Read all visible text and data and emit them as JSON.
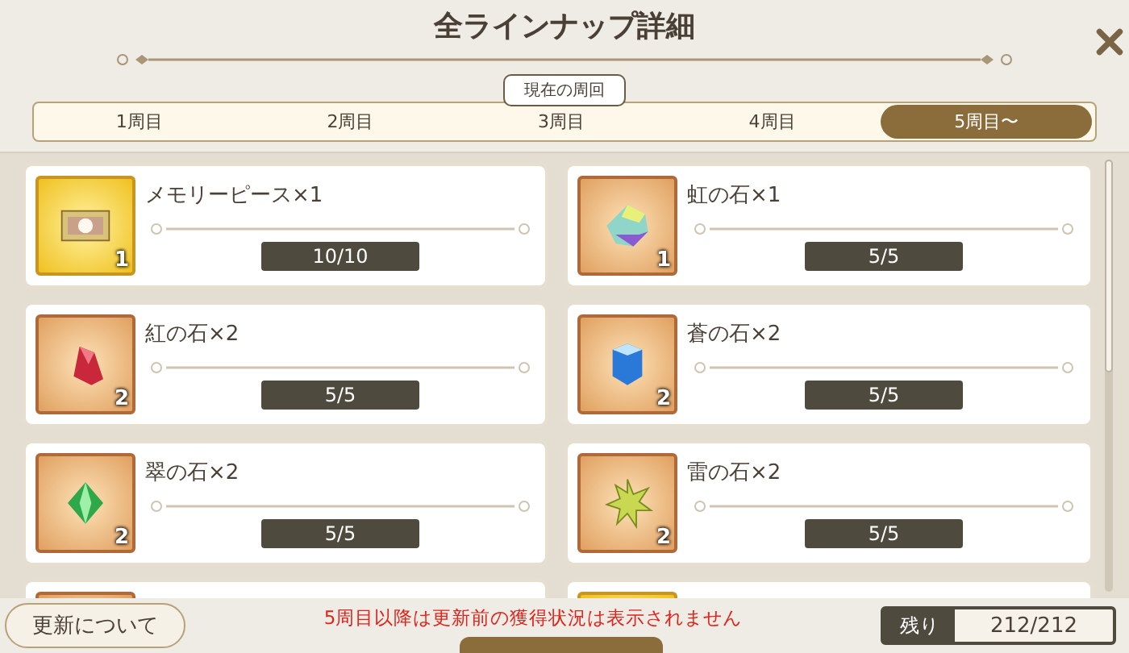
{
  "title": "全ラインナップ詳細",
  "tabs": [
    {
      "label": "1周目",
      "selected": false,
      "current": false
    },
    {
      "label": "2周目",
      "selected": false,
      "current": false
    },
    {
      "label": "3周目",
      "selected": false,
      "current": true
    },
    {
      "label": "4周目",
      "selected": false,
      "current": false
    },
    {
      "label": "5周目〜",
      "selected": true,
      "current": false
    }
  ],
  "current_tooltip": "現在の周回",
  "items": [
    {
      "kind": "film",
      "name": "メモリーピース×1",
      "count": "1",
      "progress": "10/10"
    },
    {
      "kind": "rainbow",
      "name": "虹の石×1",
      "count": "1",
      "progress": "5/5"
    },
    {
      "kind": "red",
      "name": "紅の石×2",
      "count": "2",
      "progress": "5/5"
    },
    {
      "kind": "blue",
      "name": "蒼の石×2",
      "count": "2",
      "progress": "5/5"
    },
    {
      "kind": "green",
      "name": "翠の石×2",
      "count": "2",
      "progress": "5/5"
    },
    {
      "kind": "star",
      "name": "雷の石×2",
      "count": "2",
      "progress": "5/5"
    },
    {
      "kind": "hidden_stone"
    },
    {
      "kind": "hidden_piece"
    }
  ],
  "footer": {
    "button": "更新について",
    "notice": "5周目以降は更新前の獲得状況は表示されません",
    "remaining_label": "残り",
    "remaining_value": "212/212"
  }
}
